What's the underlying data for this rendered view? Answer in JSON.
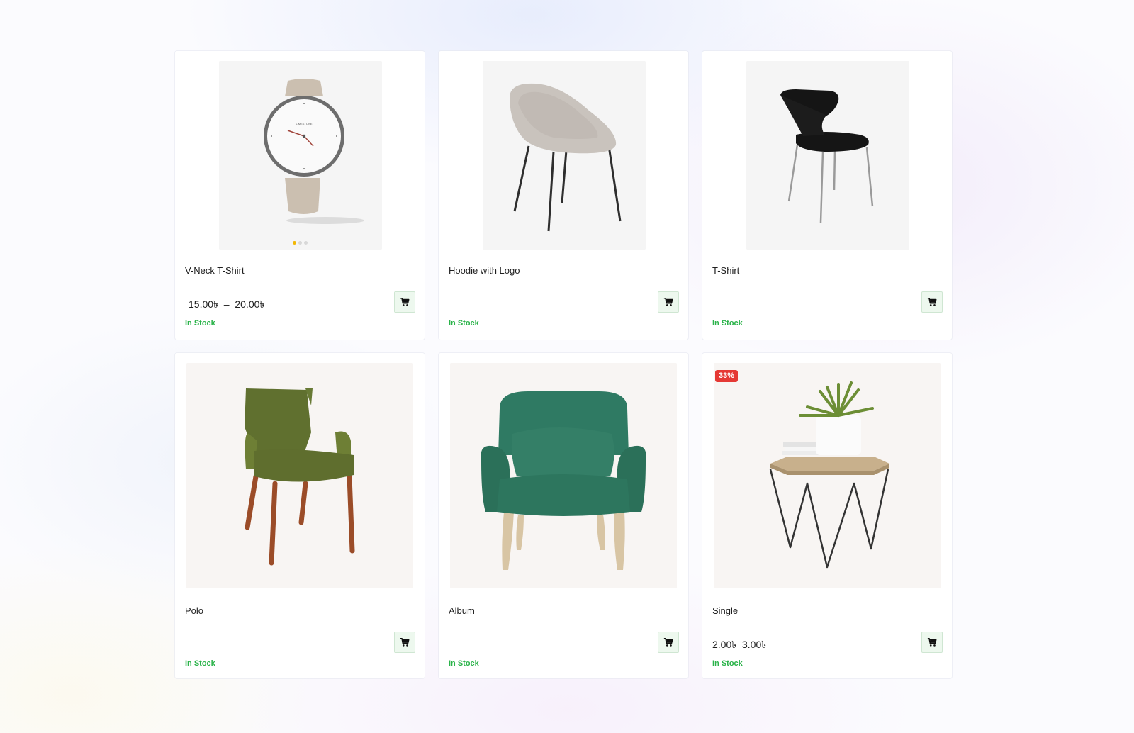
{
  "products": [
    {
      "title": "V-Neck T-Shirt",
      "price": "15.00৳  –  20.00৳",
      "stock": "In Stock",
      "image": "watch"
    },
    {
      "title": "Hoodie with Logo",
      "price": "",
      "stock": "In Stock",
      "image": "grey-shell-chair"
    },
    {
      "title": "T-Shirt",
      "price": "",
      "stock": "In Stock",
      "image": "black-chair"
    },
    {
      "title": "Polo",
      "price": "",
      "stock": "In Stock",
      "image": "olive-armchair"
    },
    {
      "title": "Album",
      "price": "",
      "stock": "In Stock",
      "image": "green-armchair"
    },
    {
      "title": "Single",
      "price": "2.00৳  3.00৳",
      "stock": "In Stock",
      "image": "side-table-plant",
      "badge": "33%"
    }
  ],
  "carousel": {
    "slides": 3,
    "active": 1
  },
  "icons": {
    "cart": "add-to-cart-icon"
  },
  "colors": {
    "stock": "#2bb34a",
    "badge": "#e53935",
    "dot_active": "#f2b705",
    "cart_bg": "#edf8ee"
  }
}
